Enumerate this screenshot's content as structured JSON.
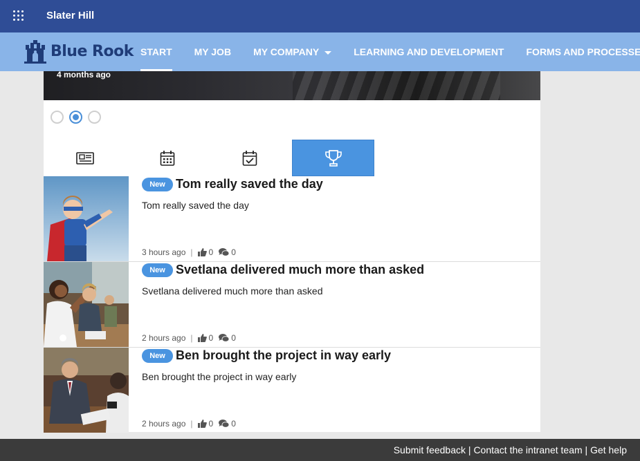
{
  "topbar": {
    "site_title": "Slater Hill",
    "waffle_icon": "app-launcher-icon"
  },
  "brand": {
    "logo_text": "Blue Rook",
    "logo_icon": "castle-icon",
    "primary": "#2f4d96",
    "nav_bg": "#89b4e8",
    "accent": "#4a94e0"
  },
  "nav": {
    "items": [
      {
        "label": "START"
      },
      {
        "label": "MY JOB"
      },
      {
        "label": "MY COMPANY"
      },
      {
        "label": "LEARNING AND DEVELOPMENT"
      },
      {
        "label": "FORMS AND PROCESSES"
      }
    ],
    "active": "START"
  },
  "hero": {
    "date": "4 months ago"
  },
  "carousel": {
    "selected": 2,
    "count": 3
  },
  "tabs": [
    {
      "icon": "newspaper-icon"
    },
    {
      "icon": "calendar-icon"
    },
    {
      "icon": "calendar-check-icon"
    },
    {
      "icon": "trophy-icon"
    }
  ],
  "active_tab": "trophy-icon",
  "feed": [
    {
      "badge": "New",
      "title": "Tom really saved the day",
      "desc": "Tom really saved the day",
      "time": "3 hours ago",
      "likes": "0",
      "comments": "0"
    },
    {
      "badge": "New",
      "title": "Svetlana delivered much more than asked",
      "desc": "Svetlana delivered much more than asked",
      "time": "2 hours ago",
      "likes": "0",
      "comments": "0"
    },
    {
      "badge": "New",
      "title": "Ben brought the project in way early",
      "desc": "Ben brought the project in way early",
      "time": "2 hours ago",
      "likes": "0",
      "comments": "0"
    }
  ],
  "footer": {
    "feedback": "Submit feedback",
    "contact": "Contact the intranet team",
    "help": "Get help",
    "separator": "|"
  }
}
